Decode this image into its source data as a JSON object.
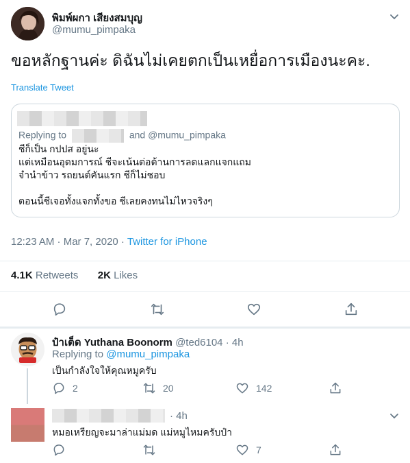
{
  "tweet": {
    "author_name": "พิมพ์ผกา เสียงสมบุญ",
    "author_handle": "@mumu_pimpaka",
    "text": "ขอหลักฐานค่ะ  ดิฉันไม่เคยตกเป็นเหยื่อการเมืองนะคะ.",
    "translate_label": "Translate Tweet",
    "time": "12:23 AM · Mar 7, 2020 · ",
    "source": "Twitter for iPhone",
    "retweets_count": "4.1K",
    "retweets_label": "Retweets",
    "likes_count": "2K",
    "likes_label": "Likes"
  },
  "quote": {
    "replying_prefix": "Replying to",
    "replying_and": "and",
    "replying_handle": "@mumu_pimpaka",
    "lines": [
      "ชีก็เป็น กปปส อยู่นะ",
      "แต่เหมือนอุดมการณ์ ชีจะเน้นต่อต้านการลดแลกแจกแถม",
      "จำนำข้าว รถยนต์คันแรก ชีก็ไม่ชอบ",
      "",
      "ตอนนี้ชีเจอทั้งแจกทั้งขอ ชีเลยคงทนไม่ไหวจริงๆ"
    ]
  },
  "replies": [
    {
      "name": "ป๋าเต็ด Yuthana Boonorm",
      "handle": "@ted6104",
      "age": "· 4h",
      "replying_prefix": "Replying to",
      "replying_handle": "@mumu_pimpaka",
      "text": "เป็นกำลังใจให้คุณหมูครับ",
      "reply_count": "2",
      "retweet_count": "20",
      "like_count": "142"
    },
    {
      "name": "",
      "age": "4h",
      "text": "หมอเหรียญจะมาล่าแม่มด แม่หมูไหมครับป๋า",
      "reply_count": "",
      "retweet_count": "",
      "like_count": "7"
    }
  ],
  "icons": [
    "chevron-down-icon",
    "reply-icon",
    "retweet-icon",
    "like-icon",
    "share-icon"
  ],
  "colors": {
    "link": "#1b95e0",
    "muted": "#657786",
    "border": "#e6ecf0"
  }
}
